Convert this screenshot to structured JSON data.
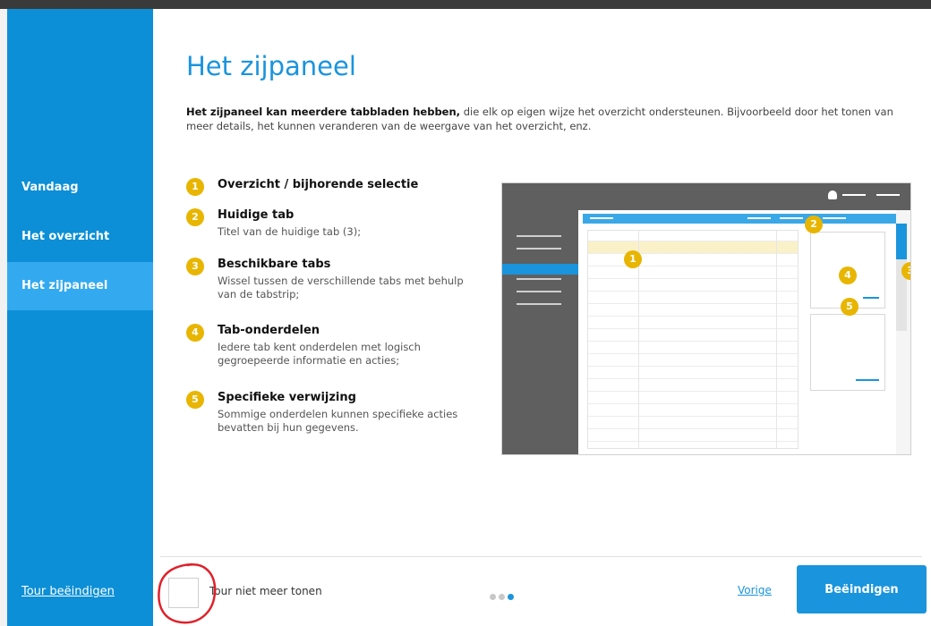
{
  "sidebar": {
    "items": [
      {
        "label": "Vandaag"
      },
      {
        "label": "Het overzicht"
      },
      {
        "label": "Het zijpaneel"
      }
    ],
    "tour_end_label": "Tour beëindigen"
  },
  "main": {
    "title": "Het zijpaneel",
    "intro_bold": "Het zijpaneel kan meerdere tabbladen hebben,",
    "intro_text": " die elk op eigen wijze het overzicht ondersteunen. Bijvoorbeeld door het tonen van meer details, het kunnen veranderen van de weergave van het overzicht, enz.",
    "steps": [
      {
        "num": "1",
        "title": "Overzicht / bijhorende selectie",
        "desc": ""
      },
      {
        "num": "2",
        "title": "Huidige tab",
        "desc": "Titel van de huidige tab (3);"
      },
      {
        "num": "3",
        "title": "Beschikbare tabs",
        "desc": "Wissel tussen de verschillende tabs met behulp van de tabstrip;"
      },
      {
        "num": "4",
        "title": "Tab-onderdelen",
        "desc": "Iedere tab kent onderdelen met logisch gegroepeerde informatie en acties;"
      },
      {
        "num": "5",
        "title": "Specifieke verwijzing",
        "desc": "Sommige onderdelen kunnen specifieke acties bevatten bij hun gegevens."
      }
    ]
  },
  "footer": {
    "checkbox_label": "Tour niet meer tonen",
    "checkbox_checked": false,
    "page_indicator": {
      "total": 3,
      "current": 3
    },
    "prev_label": "Vorige",
    "finish_label": "Beëindigen"
  },
  "colors": {
    "sidebar": "#0c8fd6",
    "sidebar_active": "#33aaf0",
    "accent": "#1a94dc",
    "badge": "#e8b500",
    "annotation_circle": "#e0202a"
  }
}
